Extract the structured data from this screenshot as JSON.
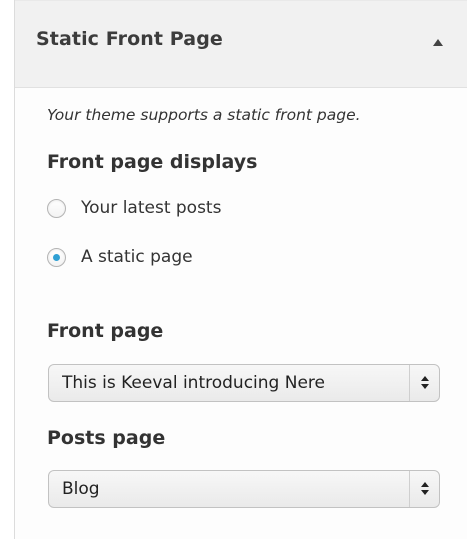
{
  "section": {
    "title": "Static Front Page",
    "description": "Your theme supports a static front page."
  },
  "front_page_displays": {
    "heading": "Front page displays",
    "options": [
      {
        "label": "Your latest posts",
        "checked": false
      },
      {
        "label": "A static page",
        "checked": true
      }
    ]
  },
  "front_page": {
    "label": "Front page",
    "selected": "This is Keeval introducing Nere"
  },
  "posts_page": {
    "label": "Posts page",
    "selected": "Blog"
  },
  "colors": {
    "accent": "#2e9fd3",
    "header_bg": "#f1f1f1"
  }
}
